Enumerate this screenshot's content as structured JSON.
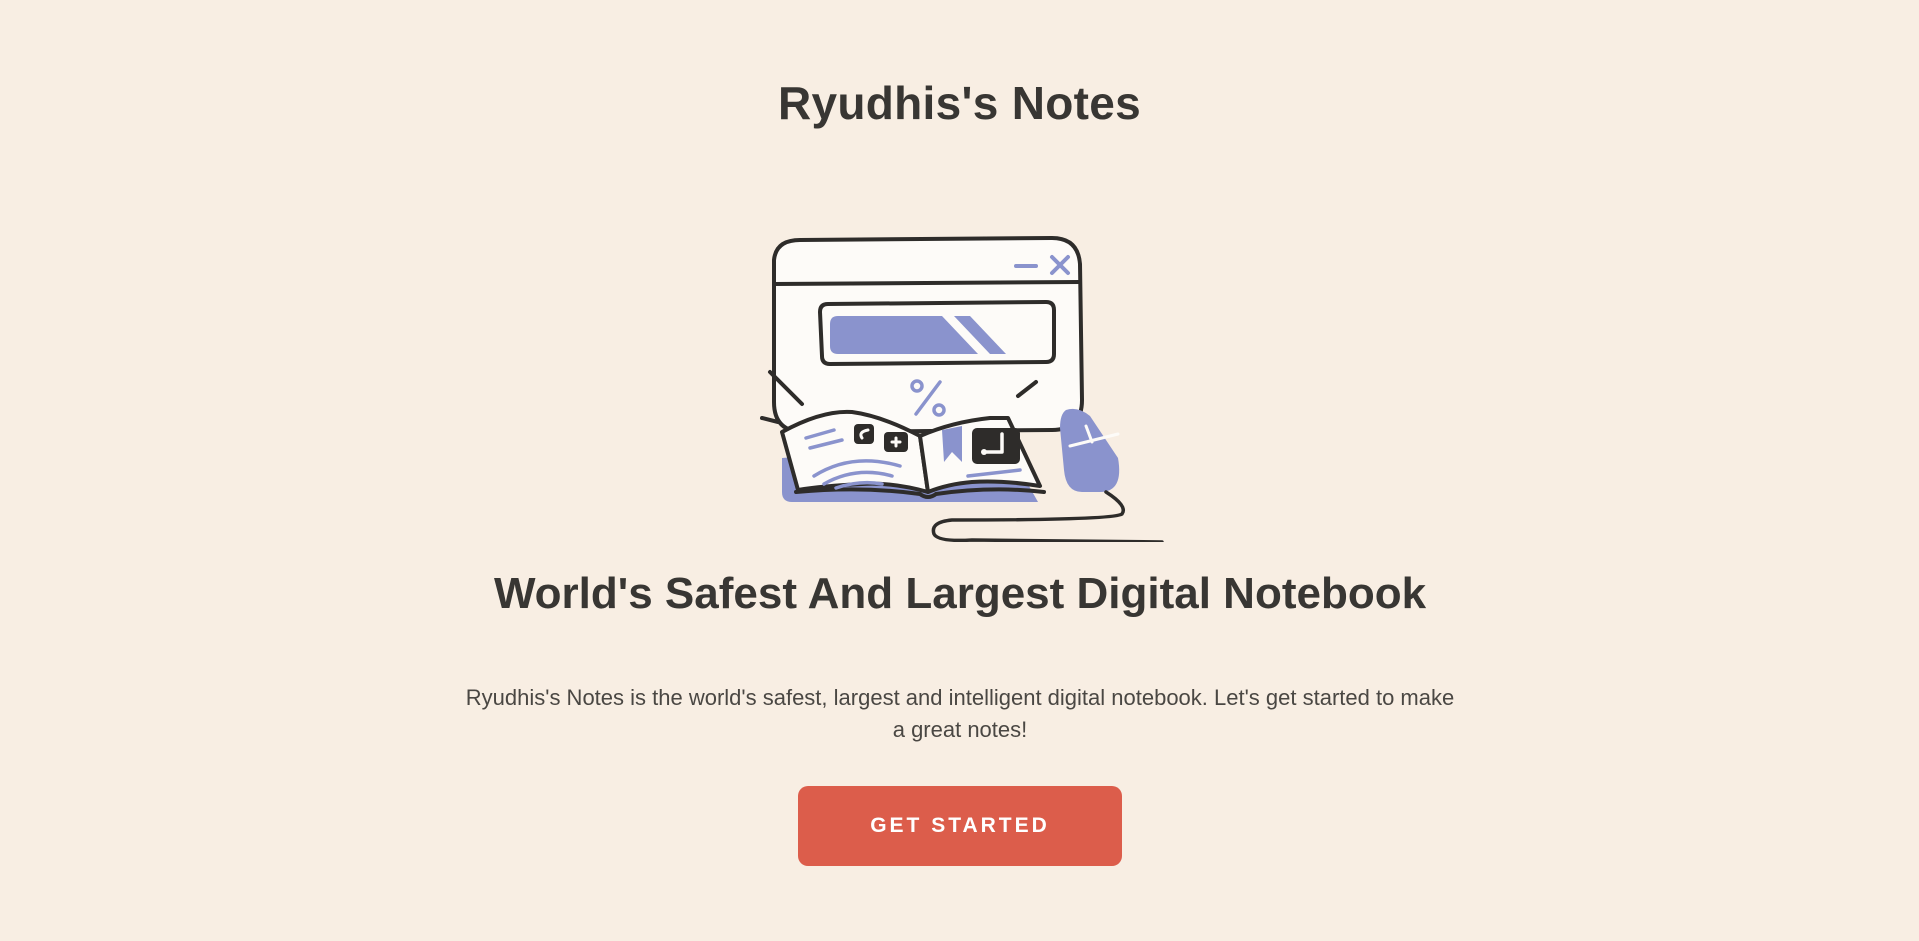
{
  "header": {
    "site_title": "Ryudhis's Notes"
  },
  "hero": {
    "illustration_icon": "notebook-computer-illustration",
    "heading": "World's Safest And Largest Digital Notebook",
    "description": "Ryudhis's Notes is the world's safest, largest and intelligent digital notebook. Let's get started to make a great notes!",
    "cta_label": "GET STARTED"
  },
  "colors": {
    "background": "#f8eee3",
    "text": "#383633",
    "accent": "#dc5d4b",
    "illustration_accent": "#8a93cd"
  }
}
